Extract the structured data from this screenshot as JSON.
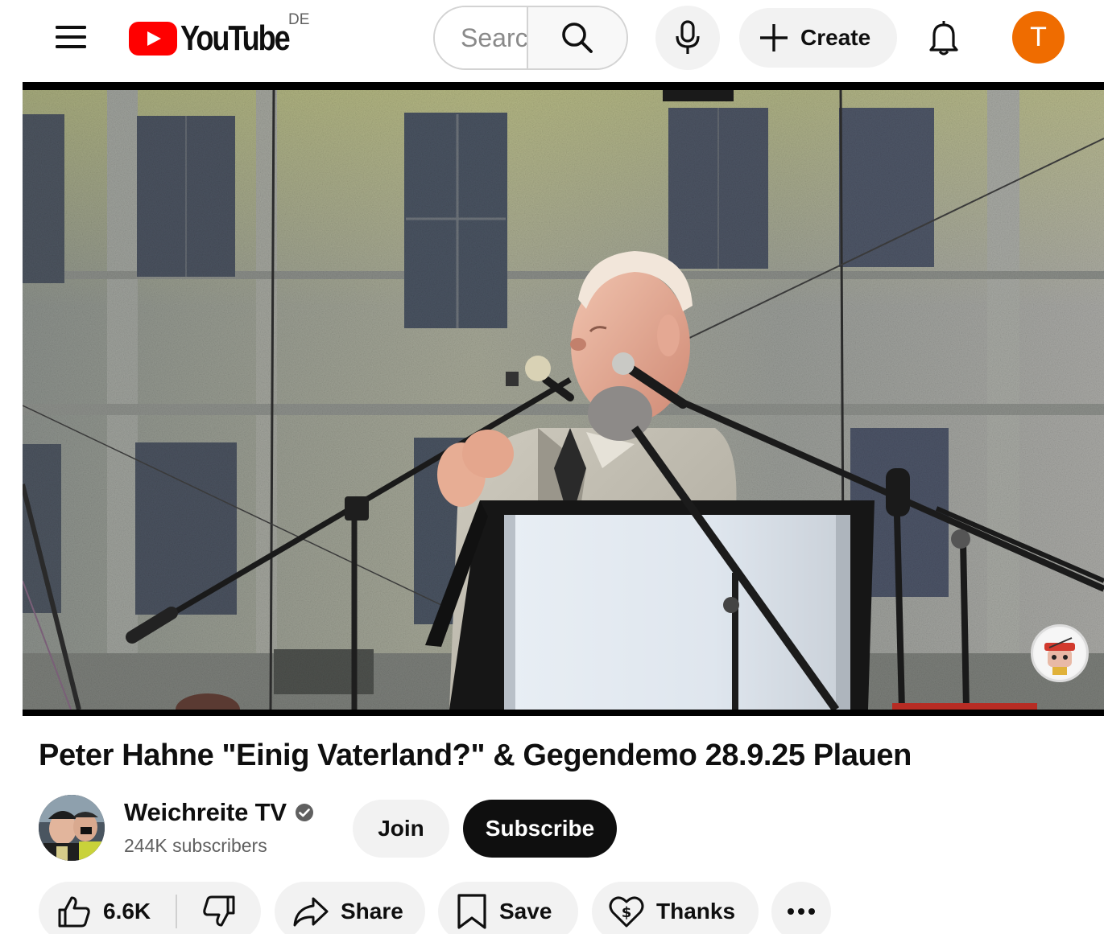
{
  "header": {
    "menu_icon": "hamburger-menu-icon",
    "logo_text": "YouTube",
    "country_code": "DE",
    "search_placeholder": "Search",
    "search_icon": "search-icon",
    "mic_icon": "microphone-icon",
    "create_label": "Create",
    "notifications_icon": "bell-icon",
    "avatar_initial": "T",
    "avatar_color": "#ef6c00"
  },
  "video": {
    "title": "Peter Hahne \"Einig Vaterland?\" & Gegendemo 28.9.25 Plauen",
    "channel": {
      "name": "Weichreite TV",
      "verified": true,
      "subscribers": "244K subscribers"
    },
    "join_label": "Join",
    "subscribe_label": "Subscribe"
  },
  "actions": {
    "likes": "6.6K",
    "share_label": "Share",
    "save_label": "Save",
    "thanks_label": "Thanks",
    "more_icon": "more-horizontal-icon"
  },
  "colors": {
    "brand_red": "#ff0000",
    "subscribe_bg": "#0f0f0f",
    "pill_bg": "#f2f2f2"
  }
}
